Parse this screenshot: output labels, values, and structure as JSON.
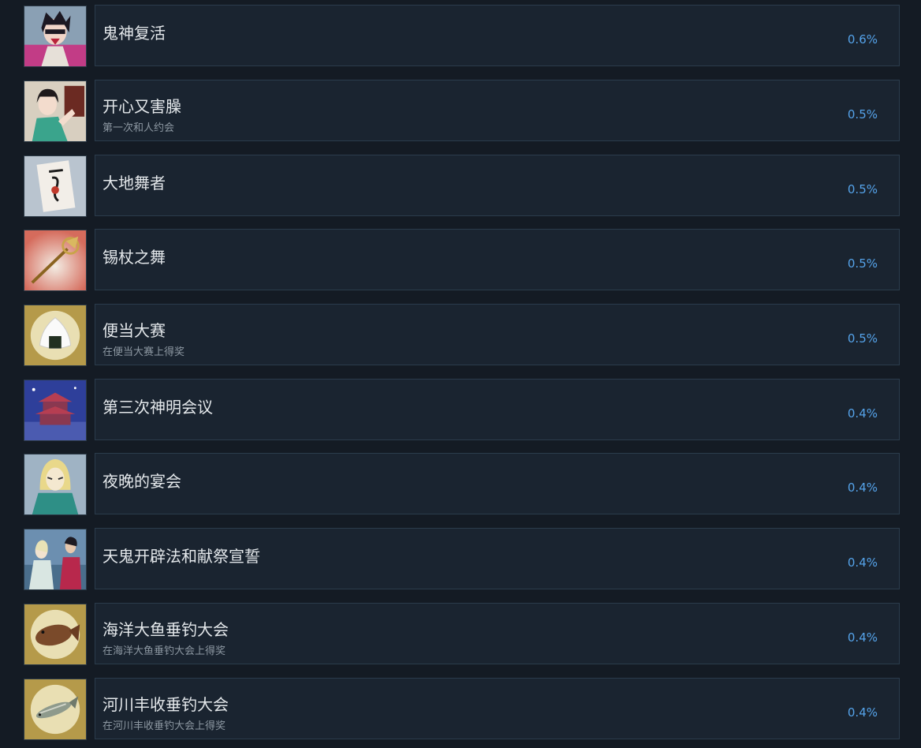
{
  "achievements": [
    {
      "title": "鬼神复活",
      "description": "",
      "percent": "0.6%",
      "icon": "demon-character-icon"
    },
    {
      "title": "开心又害臊",
      "description": "第一次和人约会",
      "percent": "0.5%",
      "icon": "shy-girl-icon"
    },
    {
      "title": "大地舞者",
      "description": "",
      "percent": "0.5%",
      "icon": "scroll-card-icon"
    },
    {
      "title": "锡杖之舞",
      "description": "",
      "percent": "0.5%",
      "icon": "staff-icon"
    },
    {
      "title": "便当大赛",
      "description": "在便当大赛上得奖",
      "percent": "0.5%",
      "icon": "rice-ball-icon"
    },
    {
      "title": "第三次神明会议",
      "description": "",
      "percent": "0.4%",
      "icon": "temple-icon"
    },
    {
      "title": "夜晚的宴会",
      "description": "",
      "percent": "0.4%",
      "icon": "masked-deity-icon"
    },
    {
      "title": "天鬼开辟法和献祭宣誓",
      "description": "",
      "percent": "0.4%",
      "icon": "two-figures-icon"
    },
    {
      "title": "海洋大鱼垂钓大会",
      "description": "在海洋大鱼垂钓大会上得奖",
      "percent": "0.4%",
      "icon": "flatfish-icon"
    },
    {
      "title": "河川丰收垂钓大会",
      "description": "在河川丰收垂钓大会上得奖",
      "percent": "0.4%",
      "icon": "river-fish-icon"
    }
  ],
  "colors": {
    "background": "#141b24",
    "card": "#1a2430",
    "card_border": "#2b3c4c",
    "title": "#e4e8eb",
    "description": "#8d98a2",
    "percent": "#55a3ea"
  }
}
